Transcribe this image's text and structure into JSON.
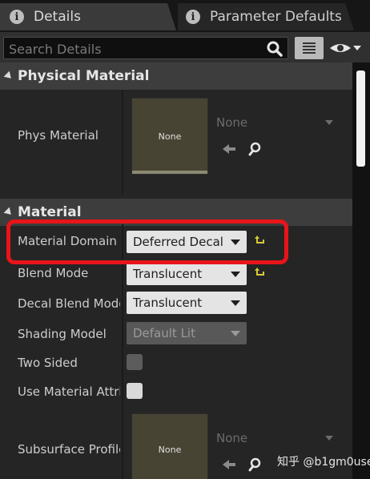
{
  "tabs": [
    {
      "label": "Details",
      "active": true
    },
    {
      "label": "Parameter Defaults",
      "active": false
    }
  ],
  "search": {
    "placeholder": "Search Details"
  },
  "categories": {
    "physical": "Physical Material",
    "material": "Material"
  },
  "physical": {
    "name": "Phys Material",
    "thumb_label": "None",
    "combo_value": "None"
  },
  "material": {
    "domain": {
      "name": "Material Domain",
      "value": "Deferred Decal"
    },
    "blend": {
      "name": "Blend Mode",
      "value": "Translucent"
    },
    "decal_blend": {
      "name": "Decal Blend Mode",
      "value": "Translucent"
    },
    "shading": {
      "name": "Shading Model",
      "value": "Default Lit"
    },
    "two_sided": {
      "name": "Two Sided"
    },
    "use_attr": {
      "name": "Use Material Attributes"
    },
    "subsurface": {
      "name": "Subsurface Profile",
      "thumb_label": "None",
      "combo_value": "None"
    }
  },
  "watermark": "知乎 @b1gm0use",
  "colors": {
    "highlight": "#e8141a",
    "reset_arrow": "#d6c93a"
  }
}
